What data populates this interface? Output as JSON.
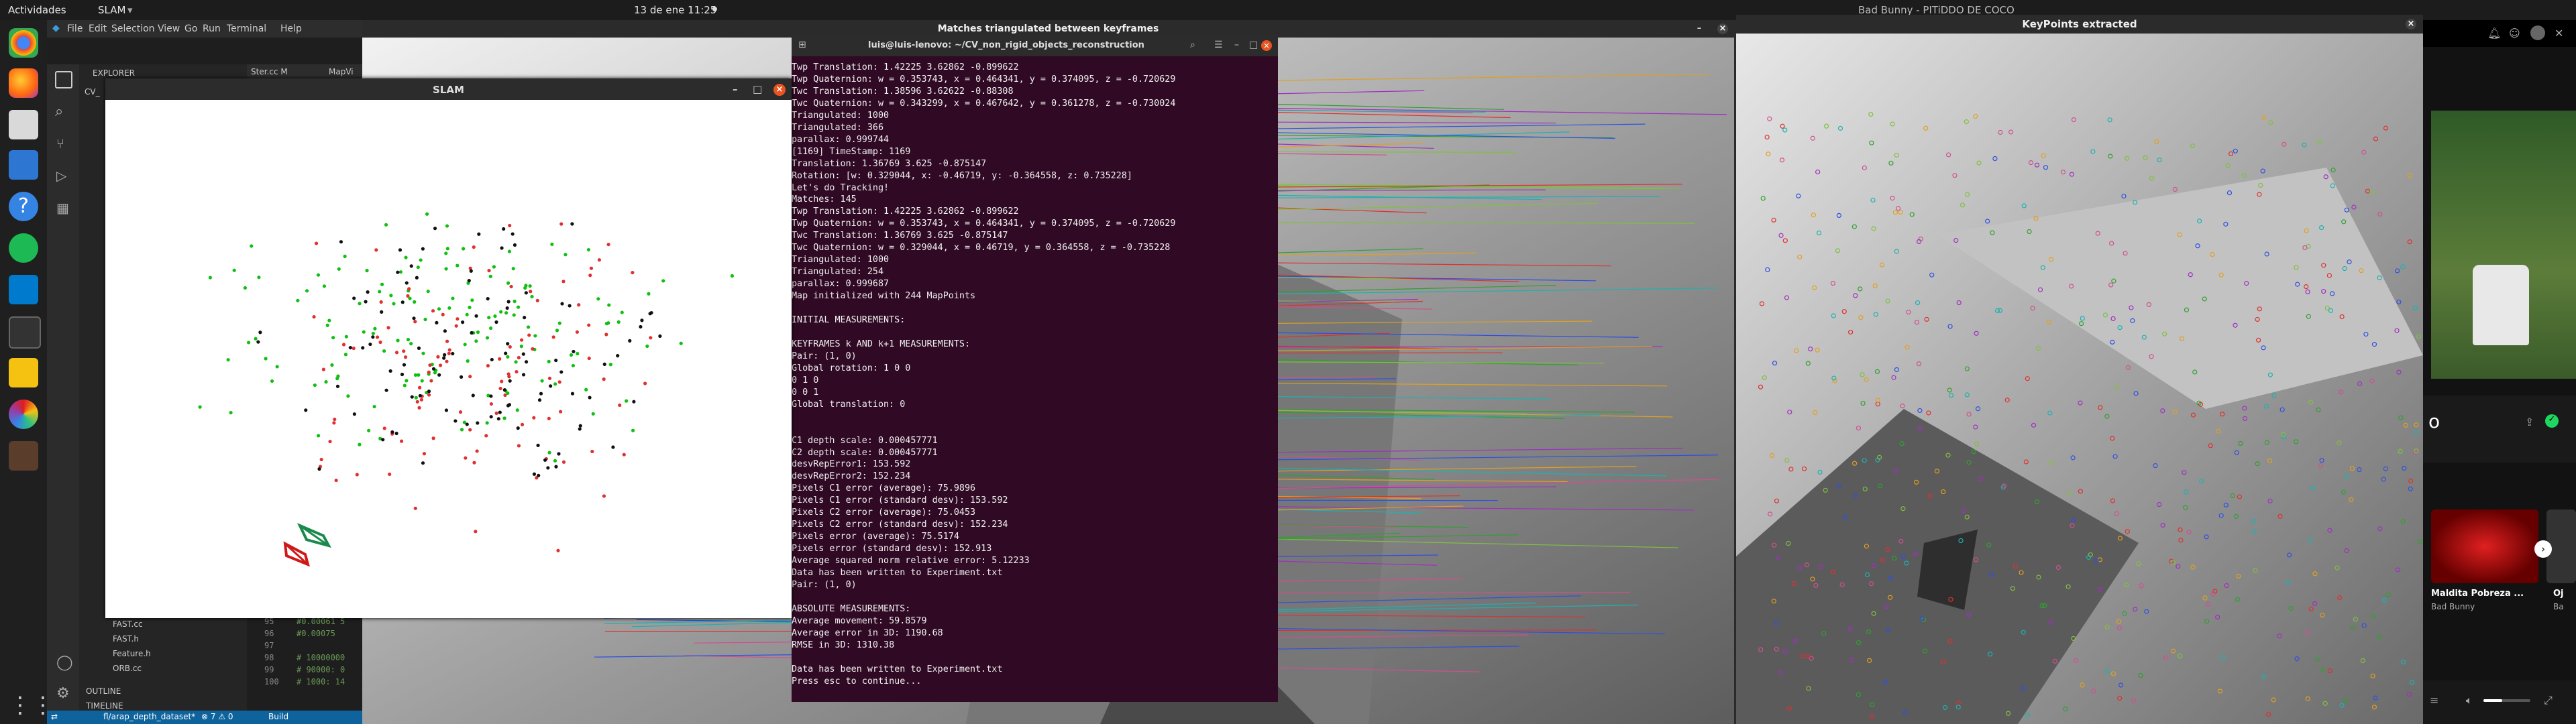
{
  "topbar": {
    "activities": "Actividades",
    "app": "SLAM",
    "clock": "13 de ene  11:25",
    "right_title": "Bad Bunny - PITiDDO DE COCO"
  },
  "vscode": {
    "menu": [
      "File",
      "Edit",
      "Selection",
      "View",
      "Go",
      "Run",
      "Terminal",
      "Help"
    ],
    "explorer_label": "EXPLORER",
    "tab1": "Ster.cc M",
    "tab2": "MapVi",
    "root": "CV_",
    "files": [
      "FAST.cc",
      "FAST.h",
      "Feature.h",
      "ORB.cc"
    ],
    "outline": "OUTLINE",
    "timeline": "TIMELINE",
    "line_numbers": [
      "95",
      "96",
      "97",
      "98",
      "99",
      "100"
    ],
    "code_lines": [
      "#0.00061 5",
      "#0.00075",
      "",
      "# 10000000",
      "# 90000: 0",
      "# 1000: 14"
    ],
    "status_branch": "fl/arap_depth_dataset*",
    "status_counts": "⊗ 7 ⚠ 0",
    "status_build": "Build"
  },
  "slam": {
    "title": "SLAM"
  },
  "terminal": {
    "title": "luis@luis-lenovo: ~/CV_non_rigid_objects_reconstruction",
    "lines": [
      "Twp Translation: 1.42225 3.62862 -0.899622",
      "Twp Quaternion: w = 0.353743, x = 0.464341, y = 0.374095, z = -0.720629",
      "Twc Translation: 1.38596 3.62622 -0.88308",
      "Twc Quaternion: w = 0.343299, x = 0.467642, y = 0.361278, z = -0.730024",
      "Triangulated: 1000",
      "Triangulated: 366",
      "parallax: 0.999744",
      "[1169] TimeStamp: 1169",
      "Translation: 1.36769 3.625 -0.875147",
      "Rotation: [w: 0.329044, x: -0.46719, y: -0.364558, z: 0.735228]",
      "Let's do Tracking!",
      "Matches: 145",
      "Twp Translation: 1.42225 3.62862 -0.899622",
      "Twp Quaternion: w = 0.353743, x = 0.464341, y = 0.374095, z = -0.720629",
      "Twc Translation: 1.36769 3.625 -0.875147",
      "Twc Quaternion: w = 0.329044, x = 0.46719, y = 0.364558, z = -0.735228",
      "Triangulated: 1000",
      "Triangulated: 254",
      "parallax: 0.999687",
      "Map initialized with 244 MapPoints",
      "",
      "INITIAL MEASUREMENTS:",
      "",
      "KEYFRAMES k AND k+1 MEASUREMENTS:",
      "Pair: (1, 0)",
      "Global rotation: 1 0 0",
      "0 1 0",
      "0 0 1",
      "Global translation: 0",
      "",
      "",
      "C1 depth scale: 0.000457771",
      "C2 depth scale: 0.000457771",
      "desvRepError1: 153.592",
      "desvRepError2: 152.234",
      "Pixels C1 error (average): 75.9896",
      "Pixels C1 error (standard desv): 153.592",
      "Pixels C2 error (average): 75.0453",
      "Pixels C2 error (standard desv): 152.234",
      "Pixels error (average): 75.5174",
      "Pixels error (standard desv): 152.913",
      "Average squared norm relative error: 5.12233",
      "Data has been written to Experiment.txt",
      "Pair: (1, 0)",
      "",
      "ABSOLUTE MEASUREMENTS:",
      "Average movement: 59.8579",
      "Average error in 3D: 1190.68",
      "RMSE in 3D: 1310.38",
      "",
      "Data has been written to Experiment.txt",
      "Press esc to continue..."
    ]
  },
  "matches": {
    "title": "Matches triangulated between keyframes"
  },
  "keypoints": {
    "title": "KeyPoints extracted"
  },
  "spotify": {
    "card1": "Maldita Pobreza ...",
    "card1_artist": "Bad Bunny",
    "card2": "Oj",
    "card2_artist": "Ba",
    "big_letter": "o"
  }
}
